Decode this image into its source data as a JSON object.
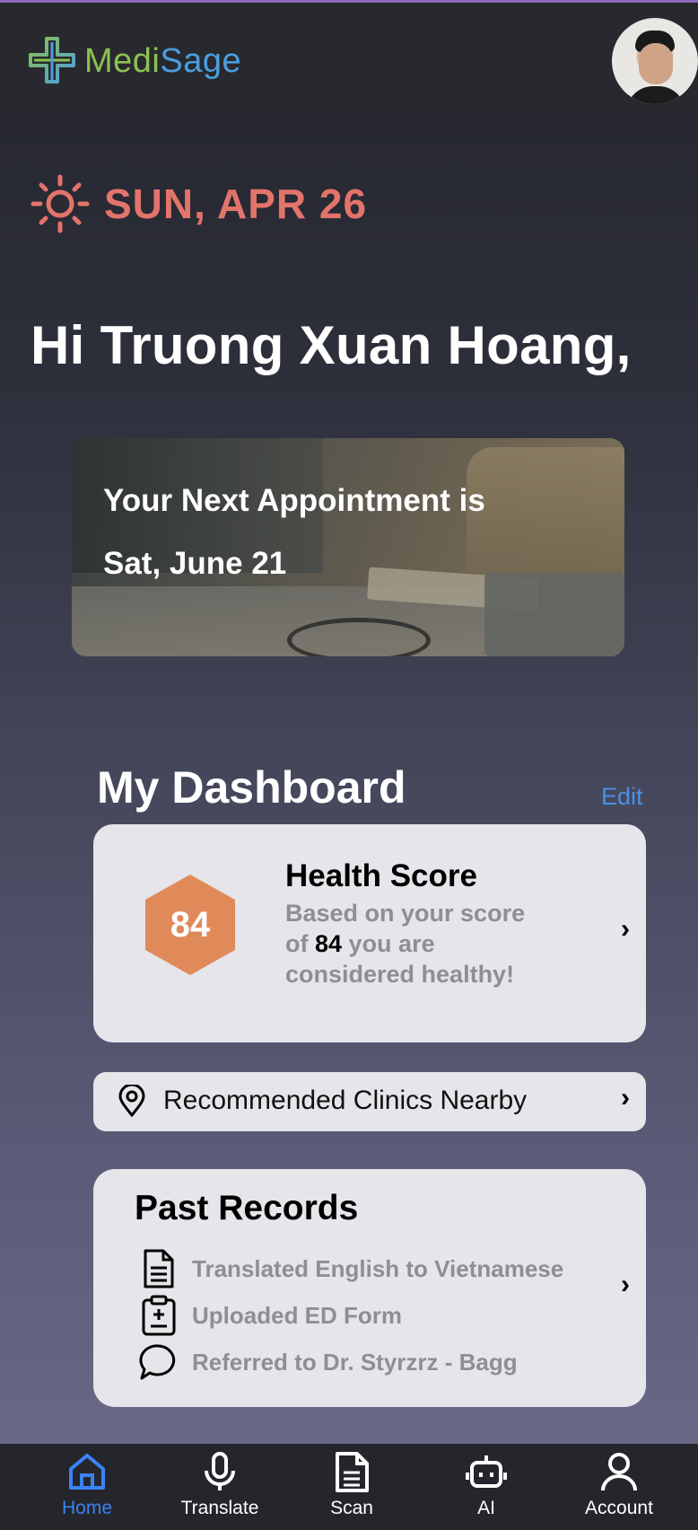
{
  "app": {
    "name_part1": "Medi",
    "name_part2": "Sage",
    "brand_colors": {
      "green": "#8cc152",
      "blue": "#4a9fe0"
    }
  },
  "date": {
    "icon": "sun-icon",
    "text": "SUN, APR 26",
    "color": "#e3746b"
  },
  "greeting": "Hi Truong Xuan Hoang,",
  "appointment": {
    "line1": "Your Next Appointment is",
    "line2": "Sat, June 21"
  },
  "dashboard": {
    "title": "My Dashboard",
    "edit_label": "Edit",
    "health_score": {
      "title": "Health Score",
      "score": "84",
      "desc_prefix": "Based on your score of ",
      "desc_score": "84",
      "desc_suffix": " you are considered healthy!",
      "badge_color": "#e08a5a"
    },
    "clinics": {
      "icon": "location-pin-icon",
      "label": "Recommended Clinics Nearby"
    },
    "past_records": {
      "title": "Past Records",
      "items": [
        {
          "icon": "document-icon",
          "label": "Translated English to Vietnamese"
        },
        {
          "icon": "medical-form-icon",
          "label": "Uploaded ED Form"
        },
        {
          "icon": "chat-bubble-icon",
          "label": "Referred to Dr. Styrzrz - Bagg"
        }
      ]
    }
  },
  "tabbar": {
    "active_color": "#3b82f6",
    "tabs": [
      {
        "icon": "home-icon",
        "label": "Home",
        "active": true
      },
      {
        "icon": "microphone-icon",
        "label": "Translate",
        "active": false
      },
      {
        "icon": "document-icon",
        "label": "Scan",
        "active": false
      },
      {
        "icon": "robot-icon",
        "label": "AI",
        "active": false
      },
      {
        "icon": "person-icon",
        "label": "Account",
        "active": false
      }
    ]
  }
}
